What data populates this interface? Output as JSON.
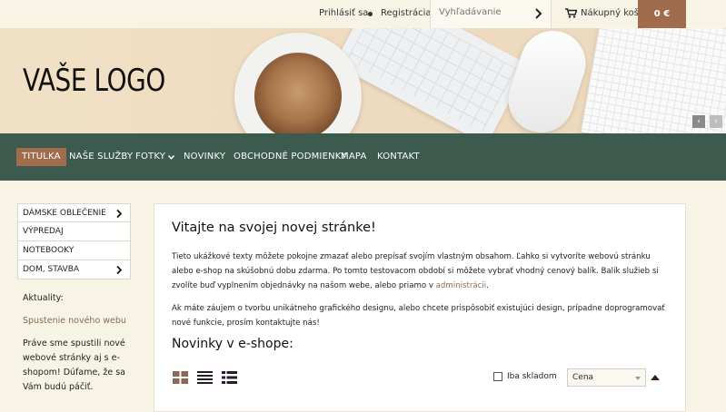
{
  "topbar": {
    "login": "Prihlásiť sa",
    "register": "Registrácia",
    "search_placeholder": "Vyhľadávanie",
    "cart_label": "Nákupný košík",
    "cart_total": "0 €"
  },
  "hero": {
    "logo": "VAŠE LOGO"
  },
  "nav": {
    "items": [
      {
        "label": "TITULKA",
        "active": true
      },
      {
        "label": "NAŠE SLUŽBY"
      },
      {
        "label": "FOTKY",
        "has_dropdown": true
      },
      {
        "label": "NOVINKY"
      },
      {
        "label": "OBCHODNÉ PODMIENKY"
      },
      {
        "label": "MAPA"
      },
      {
        "label": "KONTAKT"
      }
    ]
  },
  "sidebar": {
    "categories": [
      {
        "label": "DÁMSKE OBLEČENIE",
        "has_submenu": true
      },
      {
        "label": "VÝPREDAJ"
      },
      {
        "label": "NOTEBOOKY"
      },
      {
        "label": "DOM, STAVBA",
        "has_submenu": true
      }
    ],
    "news_title": "Aktuality:",
    "news_link": "Spustenie nového webu",
    "news_text": "Práve sme spustili nové webové stránky aj s e-shopom! Dúfame, že sa Vám budú páčiť."
  },
  "main": {
    "title": "Vitajte na svojej novej stránke!",
    "p1": "Tieto ukážkové texty môžete pokojne zmazať alebo prepísať svojím vlastným obsahom. Ľahko si vytvoríte webovú stránku alebo e-shop na skúšobnú dobu zdarma. Po tomto testovacom období si môžete vybrať vhodný cenový balík. Balík služieb si zvolíte buď vyplnením objednávky na našom webe, alebo priamo v",
    "p1_link": "administrácii",
    "p1_end": ".",
    "p2": "Ak máte záujem o tvorbu unikátneho grafického designu, alebo chcete prispôsobiť existujúci design, prípadne doprogramovať nové funkcie, prosím kontaktujte nás!",
    "subtitle": "Novinky v e-shope:",
    "in_stock_label": "Iba skladom",
    "sort_value": "Cena"
  },
  "icons": {
    "search_submit": "chevron-right-icon",
    "cart": "cart-icon",
    "view_grid": "grid-view-icon",
    "view_list": "list-view-icon",
    "view_table": "table-view-icon"
  },
  "colors": {
    "accent": "#a06c4c",
    "nav_bg": "#3c5a4e",
    "page_bg": "#f7f4e6"
  }
}
